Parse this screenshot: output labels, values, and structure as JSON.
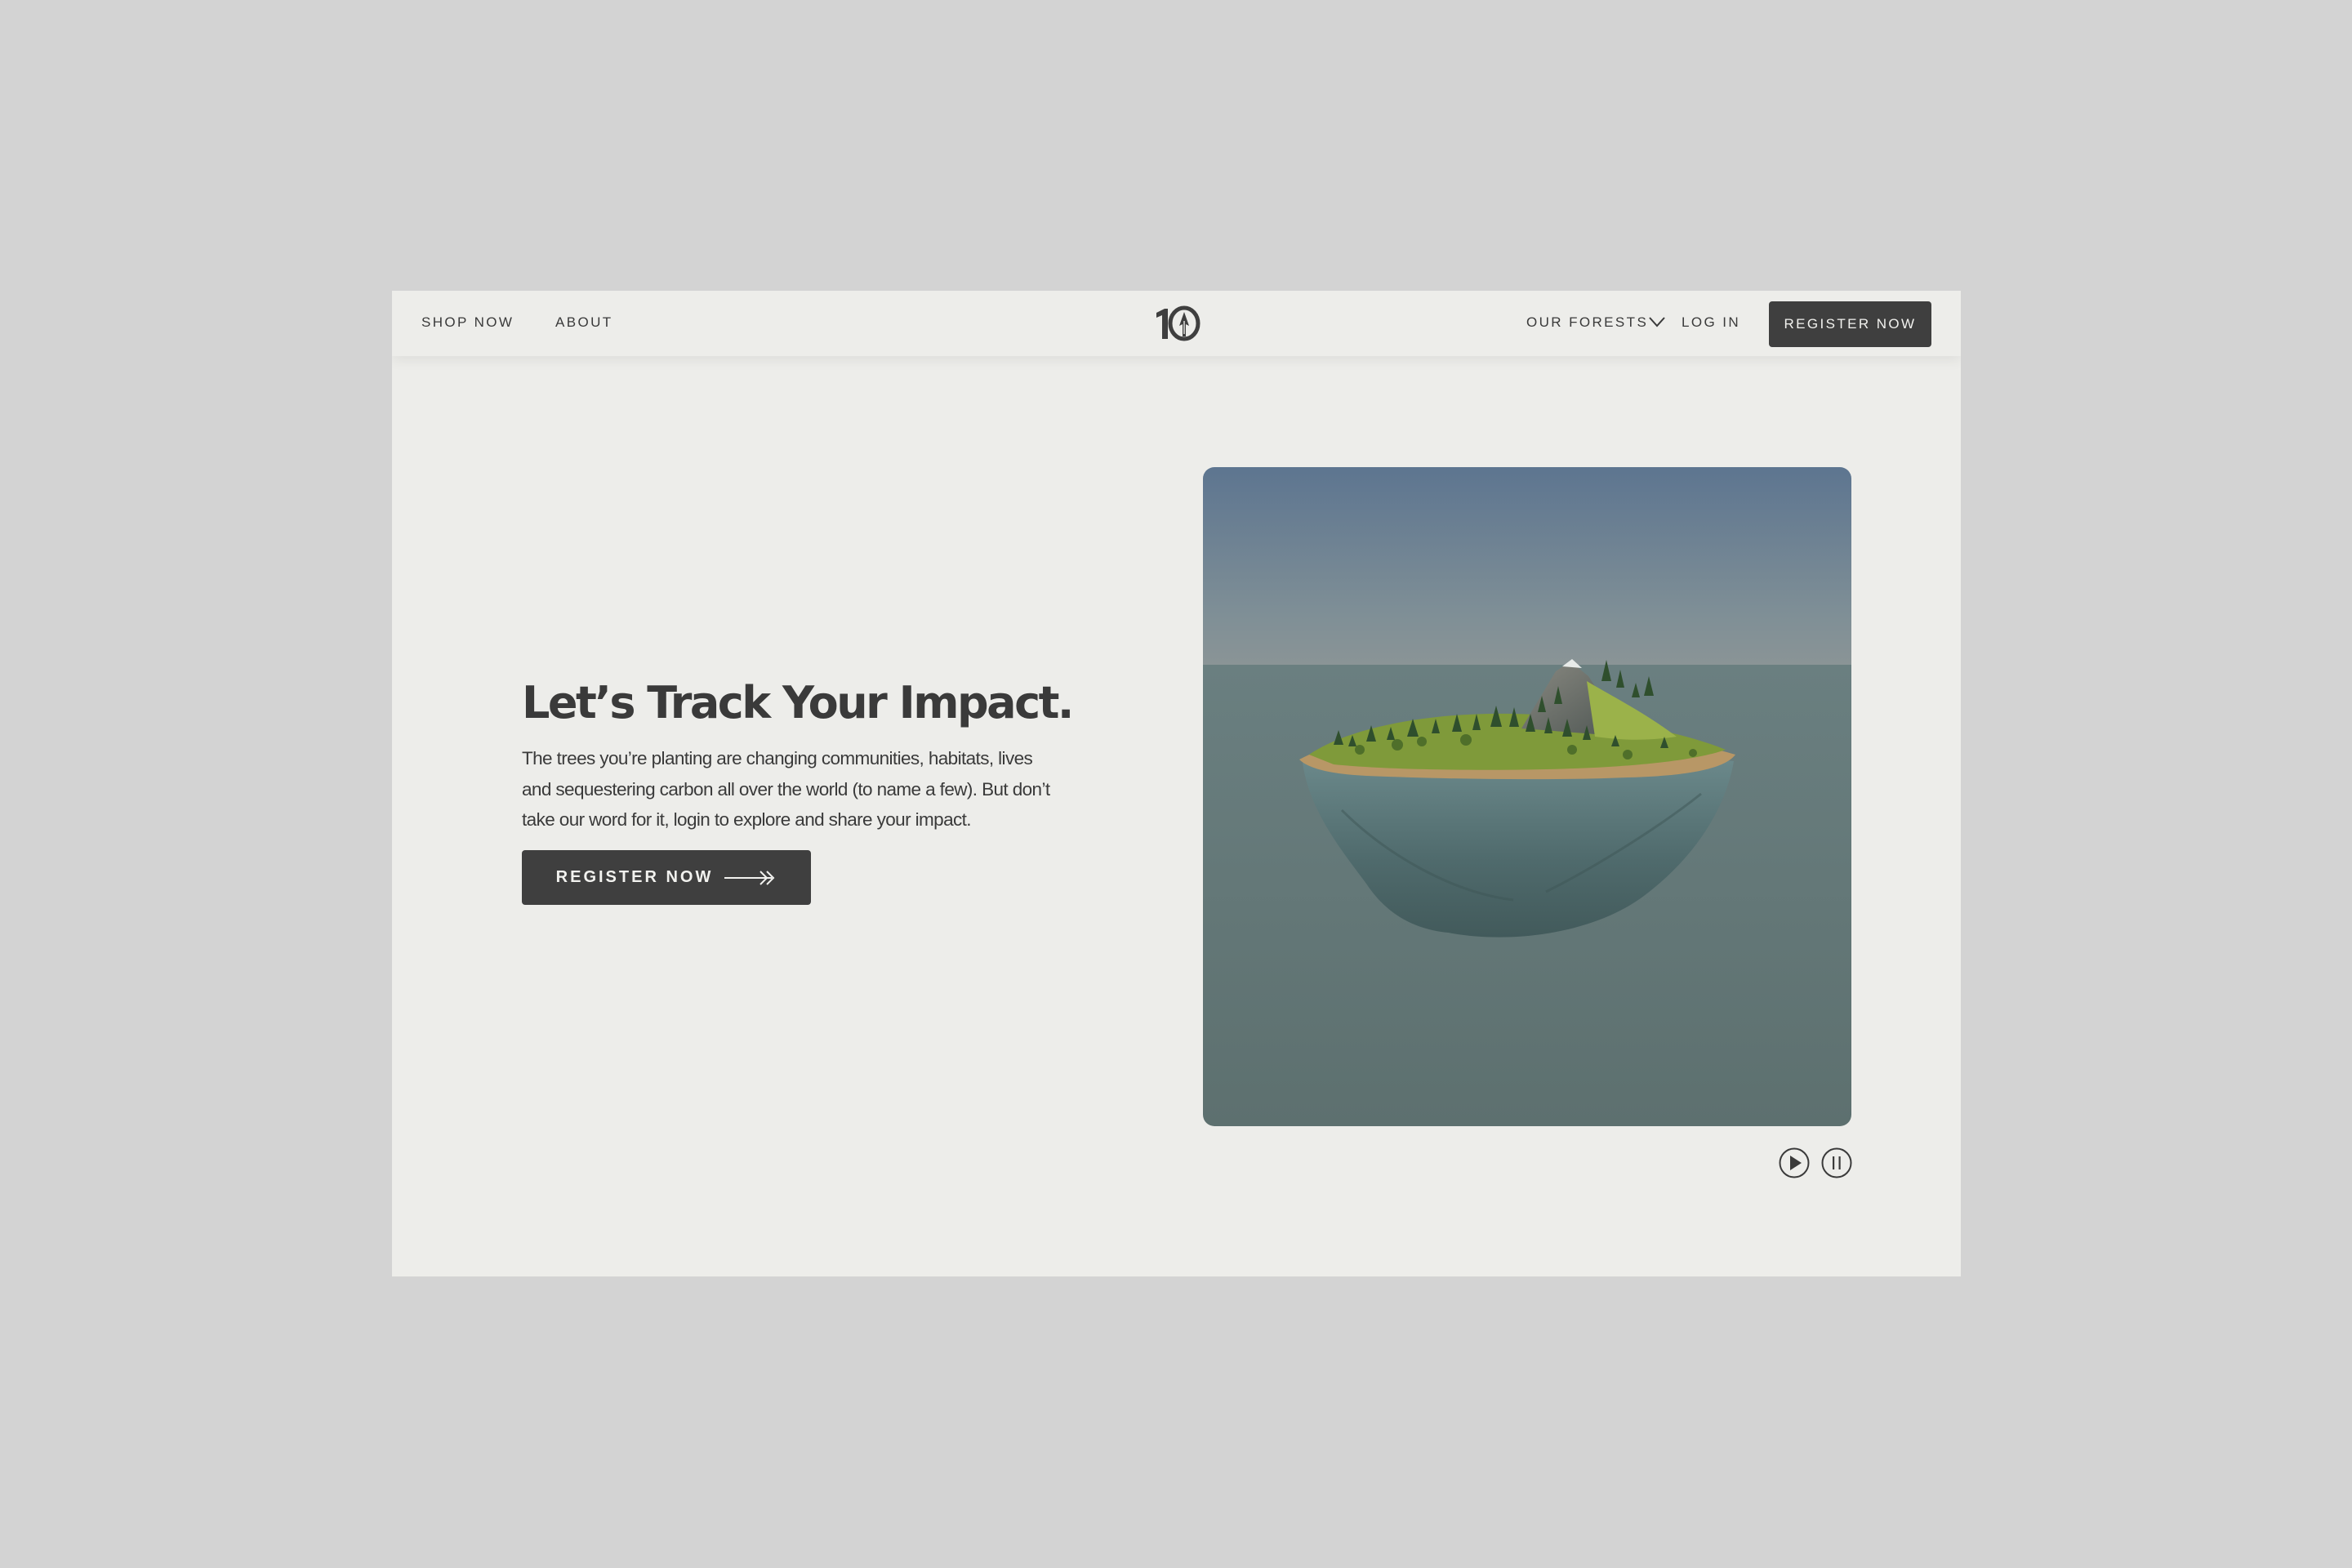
{
  "nav": {
    "shop_label": "SHOP NOW",
    "about_label": "ABOUT",
    "logo_text": "10",
    "forests_label": "OUR FORESTS",
    "login_label": "LOG IN",
    "register_label": "REGISTER NOW"
  },
  "hero": {
    "title": "Let’s Track Your Impact.",
    "body": "The trees you’re planting are changing communities, habitats, lives and sequestering carbon all over the world (to name a few). But don’t take our word for it, login to explore and share your impact.",
    "button_label": "REGISTER NOW"
  },
  "media": {
    "alt": "floating island with forest and mountain",
    "controls": [
      "play-icon",
      "pause-icon"
    ]
  },
  "colors": {
    "page_bg": "#d3d3d3",
    "window_bg": "#ededea",
    "button_bg": "#3f3f3f",
    "button_text": "#f2f2ef",
    "text": "#3a3a3a"
  }
}
